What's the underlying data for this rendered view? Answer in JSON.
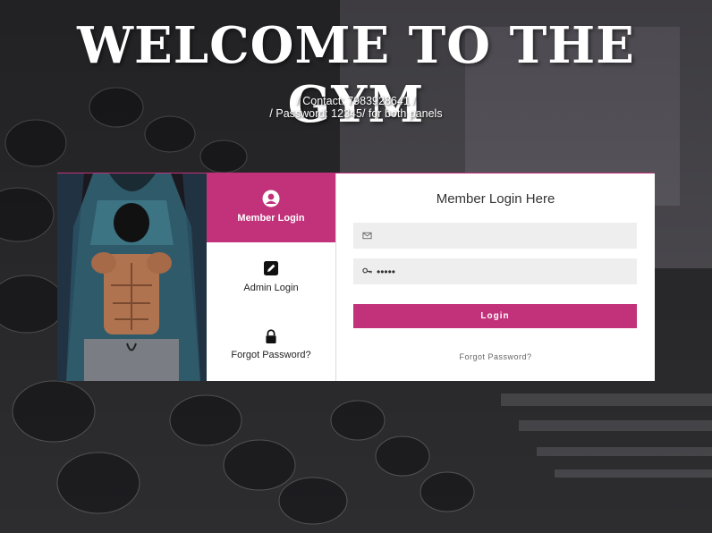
{
  "header": {
    "title": "WELCOME TO THE GYM",
    "contact_line": "/ Contact: 7983928641 /",
    "password_line": "/ Password: 12345/ for both panels"
  },
  "tabs": [
    {
      "label": "Member Login",
      "icon": "user-circle-icon",
      "active": true
    },
    {
      "label": "Admin Login",
      "icon": "edit-icon",
      "active": false
    },
    {
      "label": "Forgot Password?",
      "icon": "lock-icon",
      "active": false
    }
  ],
  "form": {
    "title": "Member Login Here",
    "email": {
      "icon": "envelope-icon",
      "value": ""
    },
    "password": {
      "icon": "key-icon",
      "value": "12345"
    },
    "login_button": "Login",
    "forgot_link": "Forgot Password?"
  },
  "colors": {
    "accent": "#c2327a",
    "field_bg": "#eeeeee",
    "white": "#ffffff"
  }
}
